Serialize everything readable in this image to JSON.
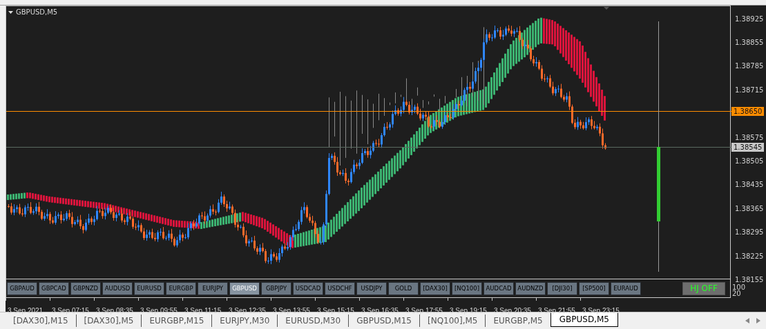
{
  "chart": {
    "title": "GBPUSD,M5",
    "price_axis": [
      "1.38925",
      "1.38855",
      "1.38785",
      "1.38715",
      "1.38575",
      "1.38505",
      "1.38435",
      "1.38365",
      "1.38295",
      "1.38225",
      "1.38155"
    ],
    "price_markers": [
      {
        "label": "1.38650",
        "kind": "line"
      },
      {
        "label": "1.38545",
        "kind": "bid"
      }
    ],
    "indicator_levels": [
      "100",
      "20"
    ]
  },
  "symbol_buttons": [
    {
      "label": "GBPAUD",
      "selected": false
    },
    {
      "label": "GBPCAD",
      "selected": false
    },
    {
      "label": "GBPNZD",
      "selected": false
    },
    {
      "label": "AUDUSD",
      "selected": false
    },
    {
      "label": "EURUSD",
      "selected": false
    },
    {
      "label": "EURGBP",
      "selected": false
    },
    {
      "label": "EURJPY",
      "selected": false
    },
    {
      "label": "GBPUSD",
      "selected": true
    },
    {
      "label": "GBPJPY",
      "selected": false
    },
    {
      "label": "USDCAD",
      "selected": false
    },
    {
      "label": "USDCHF",
      "selected": false
    },
    {
      "label": "USDJPY",
      "selected": false
    },
    {
      "label": "GOLD",
      "selected": false
    },
    {
      "label": "[DAX30]",
      "selected": false
    },
    {
      "label": "[NQ100]",
      "selected": false
    },
    {
      "label": "AUDCAD",
      "selected": false
    },
    {
      "label": "AUDNZD",
      "selected": false
    },
    {
      "label": "[DJI30]",
      "selected": false
    },
    {
      "label": "[SP500]",
      "selected": false
    },
    {
      "label": "EURAUD",
      "selected": false
    }
  ],
  "toggle_button": {
    "label": "HJ OFF"
  },
  "time_axis": [
    "3 Sep 2021",
    "3 Sep 07:15",
    "3 Sep 08:35",
    "3 Sep 09:55",
    "3 Sep 11:15",
    "3 Sep 12:35",
    "3 Sep 13:55",
    "3 Sep 15:15",
    "3 Sep 16:35",
    "3 Sep 17:55",
    "3 Sep 19:15",
    "3 Sep 20:35",
    "3 Sep 21:55",
    "3 Sep 23:15"
  ],
  "tabs": [
    {
      "label": "[DAX30],M15",
      "selected": false
    },
    {
      "label": "[DAX30],M5",
      "selected": false
    },
    {
      "label": "EURGBP,M15",
      "selected": false
    },
    {
      "label": "EURJPY,M30",
      "selected": false
    },
    {
      "label": "EURUSD,M30",
      "selected": false
    },
    {
      "label": "GBPUSD,M15",
      "selected": false
    },
    {
      "label": "[NQ100],M5",
      "selected": false
    },
    {
      "label": "EURGBP,M5",
      "selected": false
    },
    {
      "label": "GBPUSD,M5",
      "selected": true
    }
  ]
}
